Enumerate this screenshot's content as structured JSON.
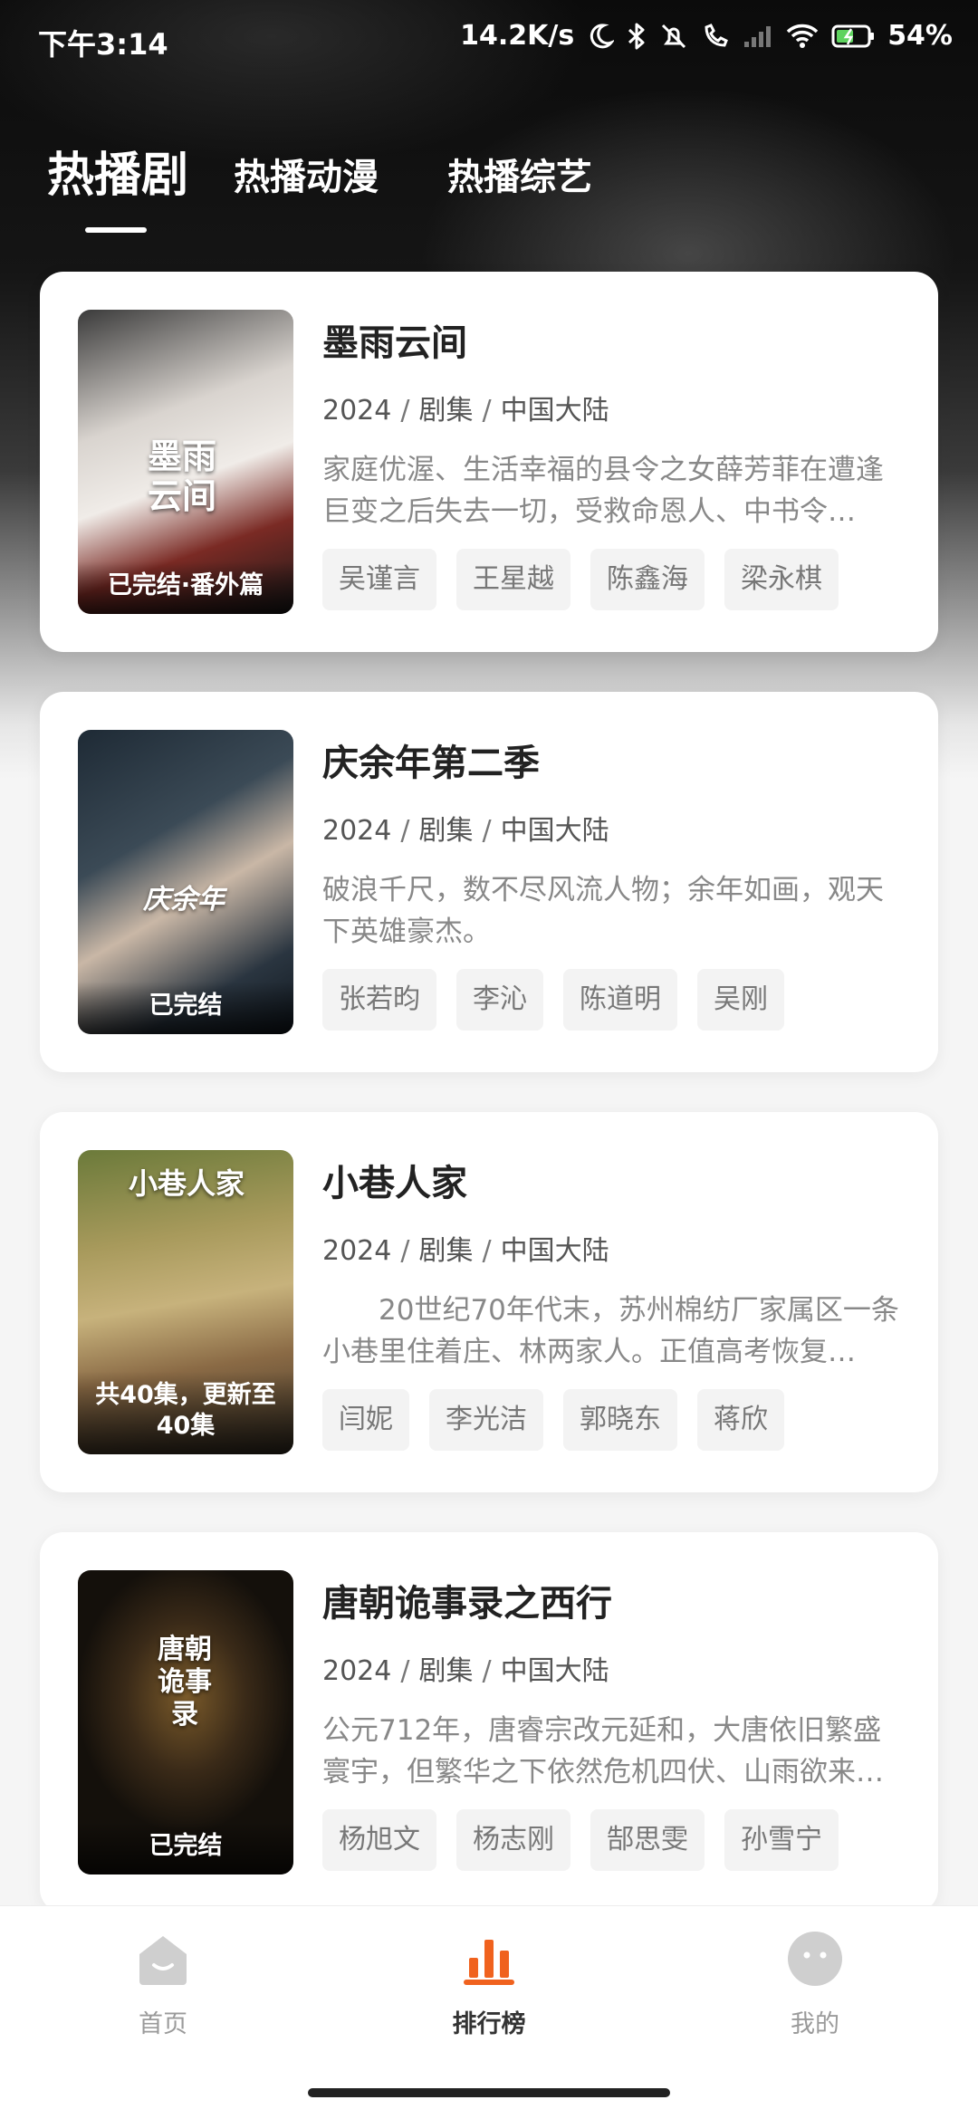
{
  "status_bar": {
    "time": "下午3:14",
    "net_speed": "14.2K/s",
    "battery": "54%"
  },
  "tabs": [
    {
      "label": "热播剧",
      "active": true
    },
    {
      "label": "热播动漫",
      "active": false
    },
    {
      "label": "热播综艺",
      "active": false
    }
  ],
  "items": [
    {
      "title": "墨雨云间",
      "year": "2024",
      "type": "剧集",
      "region": "中国大陆",
      "sep": "/",
      "desc": "家庭优渥、生活幸福的县令之女薛芳菲在遭逢巨变之后失去一切，受救命恩人、中书令…",
      "badge": "已完结·番外篇",
      "poster_title": "墨雨云间",
      "tags": [
        "吴谨言",
        "王星越",
        "陈鑫海",
        "梁永棋"
      ]
    },
    {
      "title": "庆余年第二季",
      "year": "2024",
      "type": "剧集",
      "region": "中国大陆",
      "sep": "/",
      "desc": "破浪千尺，数不尽风流人物；余年如画，观天下英雄豪杰。",
      "badge": "已完结",
      "poster_title": "庆余年",
      "tags": [
        "张若昀",
        "李沁",
        "陈道明",
        "吴刚"
      ]
    },
    {
      "title": "小巷人家",
      "year": "2024",
      "type": "剧集",
      "region": "中国大陆",
      "sep": "/",
      "desc": "　　20世纪70年代末，苏州棉纺厂家属区一条小巷里住着庄、林两家人。正值高考恢复…",
      "badge": "共40集，更新至40集",
      "poster_title": "小巷人家",
      "tags": [
        "闫妮",
        "李光洁",
        "郭晓东",
        "蒋欣"
      ]
    },
    {
      "title": "唐朝诡事录之西行",
      "year": "2024",
      "type": "剧集",
      "region": "中国大陆",
      "sep": "/",
      "desc": "公元712年，唐睿宗改元延和，大唐依旧繁盛寰宇，但繁华之下依然危机四伏、山雨欲来…",
      "badge": "已完结",
      "poster_title": "唐朝诡事录",
      "tags": [
        "杨旭文",
        "杨志刚",
        "郜思雯",
        "孙雪宁"
      ]
    }
  ],
  "nav": [
    {
      "label": "首页",
      "icon": "home-icon",
      "active": false
    },
    {
      "label": "排行榜",
      "icon": "ranking-icon",
      "active": true
    },
    {
      "label": "我的",
      "icon": "profile-icon",
      "active": false
    }
  ],
  "colors": {
    "accent": "#f0621e",
    "nav_inactive": "#cfcfcf"
  }
}
